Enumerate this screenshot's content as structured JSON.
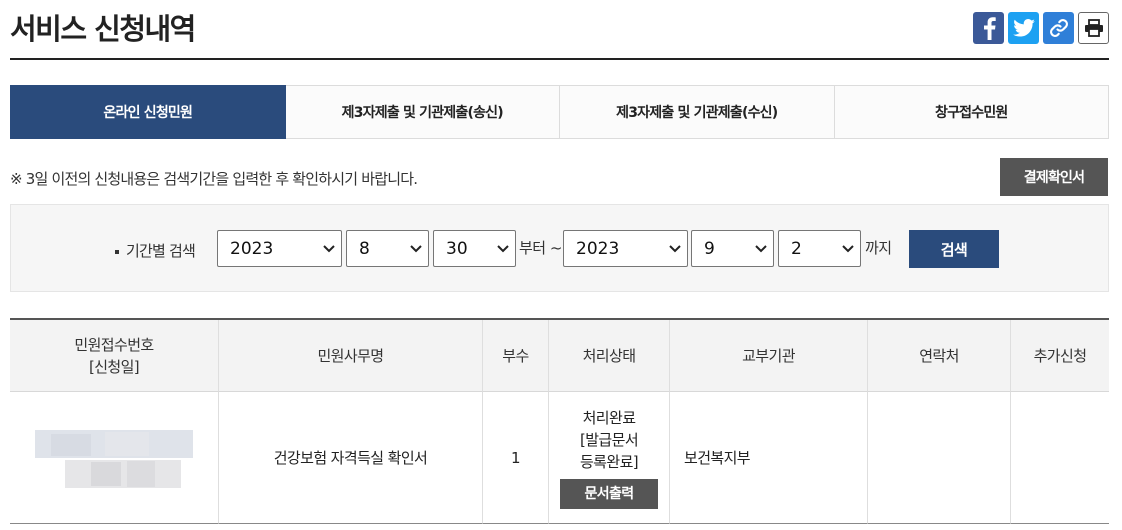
{
  "page": {
    "title": "서비스 신청내역"
  },
  "share": {
    "facebook_icon": "facebook-icon",
    "twitter_icon": "twitter-icon",
    "link_icon": "link-icon",
    "print_icon": "printer-icon"
  },
  "tabs": [
    {
      "label": "온라인 신청민원",
      "active": true
    },
    {
      "label": "제3자제출 및 기관제출(송신)",
      "active": false
    },
    {
      "label": "제3자제출 및 기관제출(수신)",
      "active": false
    },
    {
      "label": "창구접수민원",
      "active": false
    }
  ],
  "notice": "※ 3일 이전의 신청내용은 검색기간을 입력한 후 확인하시기 바랍니다.",
  "receipt_button": "결제확인서",
  "search": {
    "label": "기간별 검색",
    "from_year": "2023",
    "from_month": "8",
    "from_day": "30",
    "from_suffix": "부터 ~",
    "to_year": "2023",
    "to_month": "9",
    "to_day": "2",
    "to_suffix": "까지",
    "button": "검색"
  },
  "table": {
    "headers": [
      "민원접수번호",
      "[신청일]",
      "민원사무명",
      "부수",
      "처리상태",
      "교부기관",
      "연락처",
      "추가신청"
    ],
    "row": {
      "service_name": "건강보험 자격득실 확인서",
      "copies": "1",
      "status_line1": "처리완료",
      "status_line2": "[발급문서",
      "status_line3": "등록완료]",
      "print_button": "문서출력",
      "issuing_agency": "보건복지부",
      "contact": "",
      "additional": ""
    }
  },
  "colors": {
    "primary": "#2a4b7c",
    "dark_button": "#555555"
  }
}
